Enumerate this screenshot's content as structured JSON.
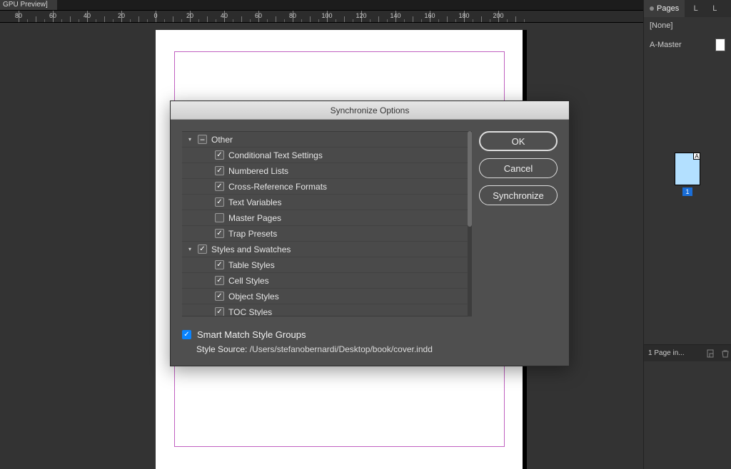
{
  "top_tab_label": "GPU Preview]",
  "ruler_marks": [
    80,
    60,
    40,
    20,
    0,
    20,
    40,
    60,
    80,
    100,
    120,
    140,
    160,
    180,
    200
  ],
  "pages_panel": {
    "tabs": [
      "Pages",
      "L",
      "L"
    ],
    "none": "[None]",
    "master": "A-Master",
    "thumb_badge": "A",
    "thumb_num": "1",
    "footer": "1 Page in..."
  },
  "dialog": {
    "title": "Synchronize Options",
    "groups": [
      {
        "label": "Other",
        "expanded": true,
        "state": "mixed",
        "items": [
          {
            "label": "Conditional Text Settings",
            "checked": true
          },
          {
            "label": "Numbered Lists",
            "checked": true
          },
          {
            "label": "Cross-Reference Formats",
            "checked": true
          },
          {
            "label": "Text Variables",
            "checked": true
          },
          {
            "label": "Master Pages",
            "checked": false
          },
          {
            "label": "Trap Presets",
            "checked": true
          }
        ]
      },
      {
        "label": "Styles and Swatches",
        "expanded": true,
        "state": "on",
        "items": [
          {
            "label": "Table Styles",
            "checked": true
          },
          {
            "label": "Cell Styles",
            "checked": true
          },
          {
            "label": "Object Styles",
            "checked": true
          },
          {
            "label": "TOC Styles",
            "checked": true
          }
        ]
      }
    ],
    "smart_match": {
      "checked": true,
      "label": "Smart Match Style Groups"
    },
    "style_source_label": "Style Source:",
    "style_source_path": "/Users/stefanobernardi/Desktop/book/cover.indd",
    "buttons": {
      "ok": "OK",
      "cancel": "Cancel",
      "sync": "Synchronize"
    }
  }
}
